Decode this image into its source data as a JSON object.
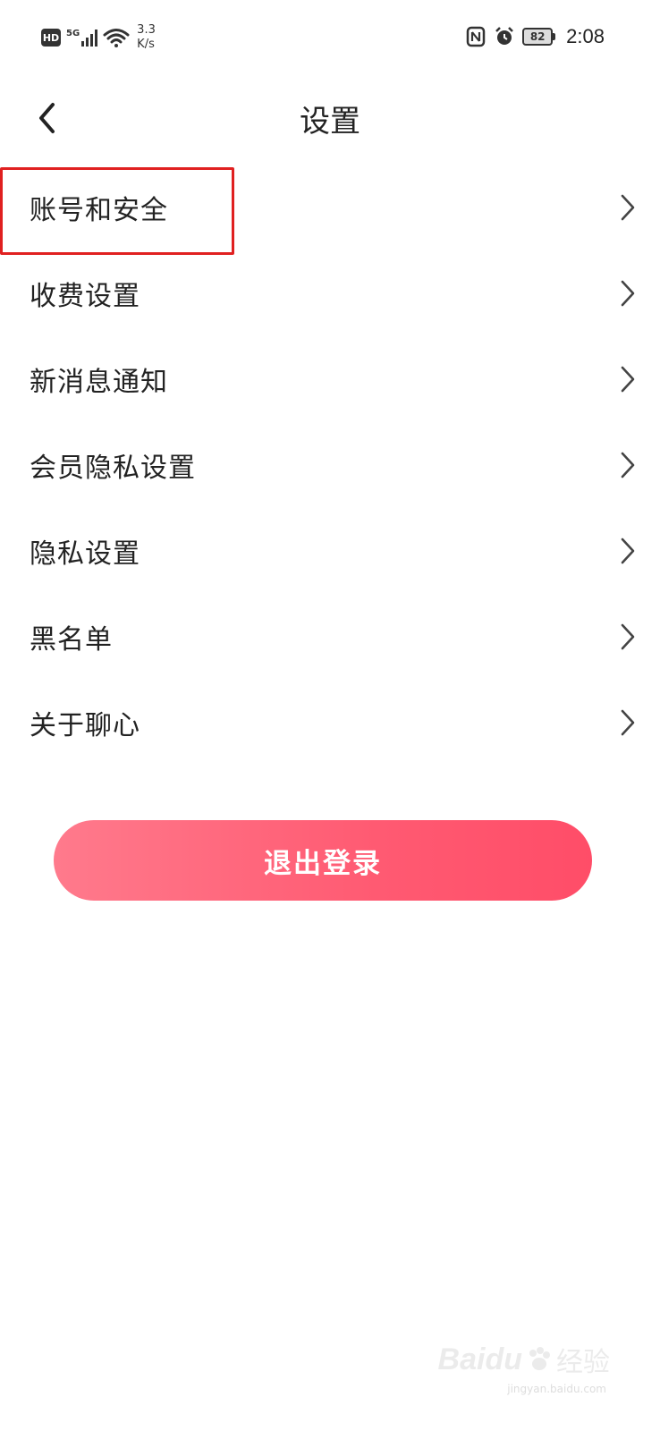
{
  "status_bar": {
    "hd": "HD",
    "network": "5G",
    "speed_value": "3.3",
    "speed_unit": "K/s",
    "battery": "82",
    "time": "2:08"
  },
  "header": {
    "title": "设置",
    "back_icon": "chevron-left-icon"
  },
  "menu": {
    "items": [
      {
        "label": "账号和安全",
        "highlighted": true
      },
      {
        "label": "收费设置"
      },
      {
        "label": "新消息通知"
      },
      {
        "label": "会员隐私设置"
      },
      {
        "label": "隐私设置"
      },
      {
        "label": "黑名单"
      },
      {
        "label": "关于聊心"
      }
    ]
  },
  "logout": {
    "label": "退出登录"
  },
  "watermark": {
    "logo": "Baidu",
    "cn": "经验",
    "url": "jingyan.baidu.com"
  },
  "colors": {
    "accent_start": "#ff7a8c",
    "accent_end": "#ff4d68",
    "highlight_border": "#e02020"
  }
}
